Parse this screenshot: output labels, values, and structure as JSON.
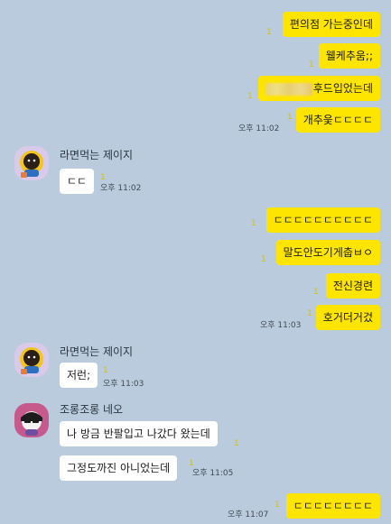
{
  "messages": {
    "m1": "편의점 가는중인데",
    "m2": "웰케추움;;",
    "m3": "후드입었는데",
    "m4": "개추웆ㄷㄷㄷㄷ",
    "t1": "오후 11:02",
    "p1_name": "라면먹는 제이지",
    "p1_msg": "ㄷㄷ",
    "t2": "오후 11:02",
    "m5": "ㄷㄷㄷㄷㄷㄷㄷㄷㄷㄷ",
    "m6": "말도안도기게춥ㅂㅇ",
    "m7": "전신경련",
    "m8": "호거더거겄",
    "t3": "오후 11:03",
    "p2_name": "라면먹는 제이지",
    "p2_msg": "저런;",
    "t4": "오후 11:03",
    "p3_name": "조롱조롱 네오",
    "p3_msg1": "나 방금 반팔입고 나갔다 왔는데",
    "p3_msg2": "그정도까진 아니었는데",
    "t5": "오후 11:05",
    "m9": "ㄷㄷㄷㄷㄷㄷㄷㄷ",
    "t6": "오후 11:07",
    "read_mark": "1"
  },
  "colors": {
    "background": "#b9cbdc",
    "my_bubble": "#fee500",
    "their_bubble": "#ffffff"
  },
  "icons": {
    "avatar1": "jay-g-avatar",
    "avatar2": "neo-avatar"
  }
}
